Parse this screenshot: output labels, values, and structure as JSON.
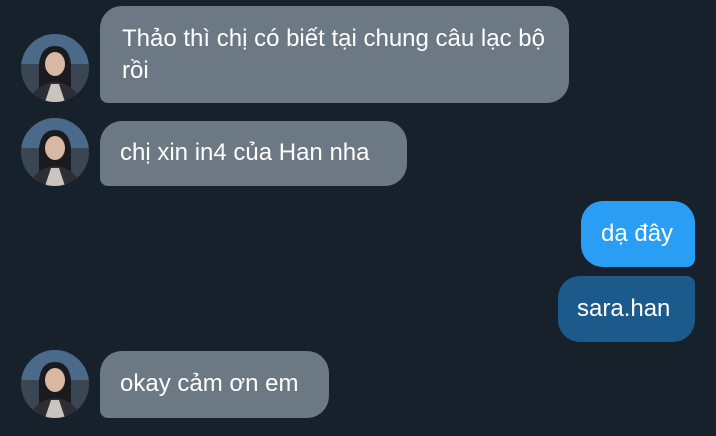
{
  "messages": [
    {
      "direction": "incoming",
      "text": "Thảo thì chị có biết tại chung câu lạc bộ rồi"
    },
    {
      "direction": "incoming",
      "text": "chị xin in4 của Han nha"
    },
    {
      "direction": "outgoing",
      "text": "dạ đây"
    },
    {
      "direction": "outgoing",
      "text": "sara.han"
    },
    {
      "direction": "incoming",
      "text": "okay cảm ơn em"
    }
  ],
  "colors": {
    "background": "#17212b",
    "incoming_bubble": "#6c7883",
    "outgoing_bubble_light": "#2a9df4",
    "outgoing_bubble_dark": "#1d5a8c"
  },
  "icons": [
    "contact-avatar"
  ]
}
